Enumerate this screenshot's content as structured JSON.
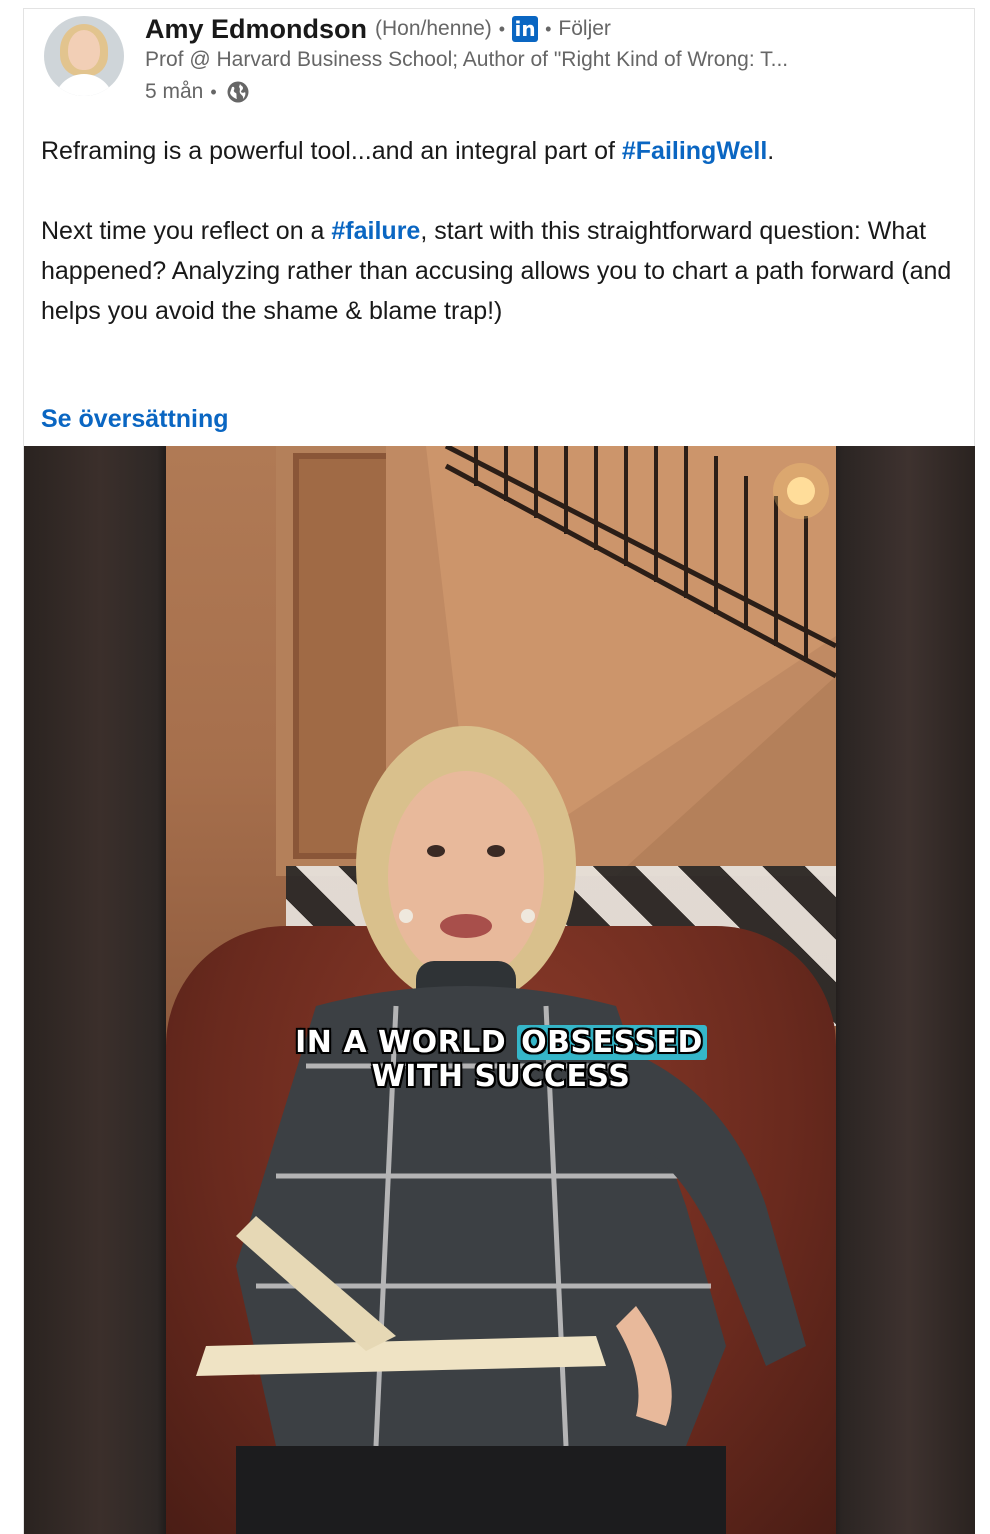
{
  "post": {
    "author": {
      "name": "Amy Edmondson",
      "pronouns": "(Hon/henne)",
      "badge_label": "in",
      "follow_status": "Följer",
      "headline": "Prof @ Harvard Business School; Author of \"Right Kind of Wrong: T...",
      "time_ago": "5 mån",
      "visibility_icon": "globe-icon"
    },
    "text": {
      "para1_prefix": "Reframing is a powerful tool...and an integral part of ",
      "para1_tag": "#FailingWell",
      "para1_suffix": ".",
      "para2_prefix": "Next time you reflect on a ",
      "para2_tag": "#failure",
      "para2_suffix": ", start with this straightforward question: What happened? Analyzing rather than accusing allows you to chart a path forward (and helps you avoid the shame & blame trap!)"
    },
    "translate_link": "Se översättning",
    "video": {
      "caption_part1": "IN A WORLD ",
      "caption_highlight": "OBSESSED",
      "caption_line2": "WITH SUCCESS"
    }
  },
  "colors": {
    "link_blue": "#0a66c2",
    "caption_highlight": "#35b6c9",
    "secondary_text": "#666666"
  }
}
